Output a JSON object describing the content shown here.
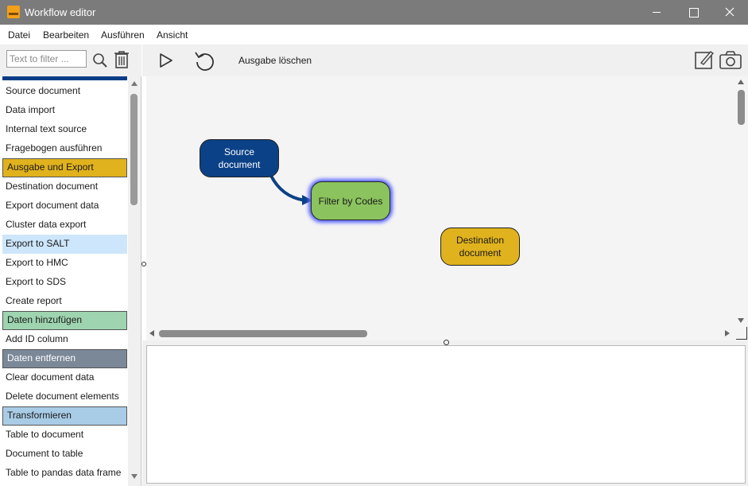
{
  "window": {
    "title": "Workflow editor"
  },
  "menu": [
    "Datei",
    "Bearbeiten",
    "Ausführen",
    "Ansicht"
  ],
  "sidebar": {
    "filter_placeholder": "Text to filter ...",
    "items": [
      {
        "label": "Source document",
        "kind": "item",
        "color": ""
      },
      {
        "label": "Data import",
        "kind": "item",
        "color": ""
      },
      {
        "label": "Internal text source",
        "kind": "item",
        "color": ""
      },
      {
        "label": "Fragebogen ausführen",
        "kind": "item",
        "color": ""
      },
      {
        "label": "Ausgabe und Export",
        "kind": "category",
        "color": "#e0b21d"
      },
      {
        "label": "Destination document",
        "kind": "item",
        "color": ""
      },
      {
        "label": "Export document data",
        "kind": "item",
        "color": ""
      },
      {
        "label": "Cluster data export",
        "kind": "item",
        "color": ""
      },
      {
        "label": "Export to SALT",
        "kind": "selected",
        "color": "#cde6fb"
      },
      {
        "label": "Export to HMC",
        "kind": "item",
        "color": ""
      },
      {
        "label": "Export to SDS",
        "kind": "item",
        "color": ""
      },
      {
        "label": "Create report",
        "kind": "item",
        "color": ""
      },
      {
        "label": "Daten hinzufügen",
        "kind": "category",
        "color": "#9ed4b0"
      },
      {
        "label": "Add ID column",
        "kind": "item",
        "color": ""
      },
      {
        "label": "Daten entfernen",
        "kind": "category",
        "color": "#7b8898"
      },
      {
        "label": "Clear document data",
        "kind": "item",
        "color": ""
      },
      {
        "label": "Delete document elements",
        "kind": "item",
        "color": ""
      },
      {
        "label": "Transformieren",
        "kind": "category",
        "color": "#a9cce6"
      },
      {
        "label": "Table to document",
        "kind": "item",
        "color": ""
      },
      {
        "label": "Document to table",
        "kind": "item",
        "color": ""
      },
      {
        "label": "Table to pandas data frame",
        "kind": "item",
        "color": ""
      }
    ]
  },
  "toolbar": {
    "clear_output_label": "Ausgabe löschen",
    "icons": [
      "play-icon",
      "reset-icon",
      "draw-icon",
      "camera-icon"
    ]
  },
  "workflow": {
    "nodes": {
      "source": {
        "label": "Source document",
        "color": "#0b4186"
      },
      "filter": {
        "label": "Filter by Codes",
        "color": "#8bc35e",
        "selected": true
      },
      "destination": {
        "label": "Destination document",
        "color": "#e0b21d"
      }
    },
    "edges": [
      {
        "from": "source",
        "to": "filter",
        "color": "#0b4186"
      }
    ]
  },
  "output": {
    "text": ""
  }
}
